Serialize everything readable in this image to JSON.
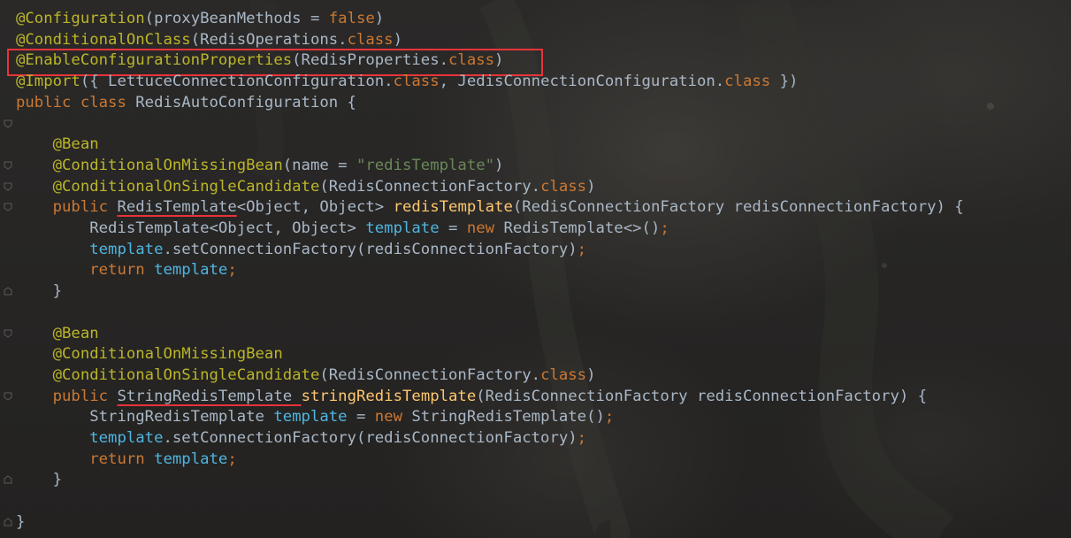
{
  "editor": {
    "lines": [
      {
        "kind": "plain",
        "tokens": [
          {
            "t": "ann",
            "v": "@Configuration"
          },
          {
            "t": "plain",
            "v": "(proxyBeanMethods = "
          },
          {
            "t": "kw",
            "v": "false"
          },
          {
            "t": "plain",
            "v": ")"
          }
        ]
      },
      {
        "kind": "plain",
        "tokens": [
          {
            "t": "ann",
            "v": "@ConditionalOnClass"
          },
          {
            "t": "plain",
            "v": "(RedisOperations."
          },
          {
            "t": "kw",
            "v": "class"
          },
          {
            "t": "plain",
            "v": ")"
          }
        ]
      },
      {
        "kind": "boxed",
        "tokens": [
          {
            "t": "ann",
            "v": "@EnableConfigurationProperties"
          },
          {
            "t": "plain",
            "v": "(RedisProperties."
          },
          {
            "t": "kw",
            "v": "class"
          },
          {
            "t": "plain",
            "v": ")"
          }
        ]
      },
      {
        "kind": "plain",
        "tokens": [
          {
            "t": "ann",
            "v": "@Import"
          },
          {
            "t": "plain",
            "v": "({ LettuceConnectionConfiguration."
          },
          {
            "t": "kw",
            "v": "class"
          },
          {
            "t": "plain",
            "v": ", JedisConnectionConfiguration."
          },
          {
            "t": "kw",
            "v": "class"
          },
          {
            "t": "plain",
            "v": " })"
          }
        ]
      },
      {
        "kind": "plain",
        "tokens": [
          {
            "t": "kw",
            "v": "public class "
          },
          {
            "t": "plain",
            "v": "RedisAutoConfiguration {"
          }
        ]
      },
      {
        "kind": "blank",
        "tokens": []
      },
      {
        "kind": "plain",
        "tokens": [
          {
            "t": "plain",
            "v": "    "
          },
          {
            "t": "ann",
            "v": "@Bean"
          }
        ]
      },
      {
        "kind": "plain",
        "tokens": [
          {
            "t": "plain",
            "v": "    "
          },
          {
            "t": "ann",
            "v": "@ConditionalOnMissingBean"
          },
          {
            "t": "plain",
            "v": "(name = "
          },
          {
            "t": "str",
            "v": "\"redisTemplate\""
          },
          {
            "t": "plain",
            "v": ")"
          }
        ]
      },
      {
        "kind": "plain",
        "tokens": [
          {
            "t": "plain",
            "v": "    "
          },
          {
            "t": "ann",
            "v": "@ConditionalOnSingleCandidate"
          },
          {
            "t": "plain",
            "v": "(RedisConnectionFactory."
          },
          {
            "t": "kw",
            "v": "class"
          },
          {
            "t": "plain",
            "v": ")"
          }
        ]
      },
      {
        "kind": "plain",
        "tokens": [
          {
            "t": "plain",
            "v": "    "
          },
          {
            "t": "kw",
            "v": "public "
          },
          {
            "t": "plain ul",
            "v": "RedisTemplate"
          },
          {
            "t": "plain",
            "v": "<Object, Object> "
          },
          {
            "t": "fn",
            "v": "redisTemplate"
          },
          {
            "t": "plain",
            "v": "(RedisConnectionFactory redisConnectionFactory) {"
          }
        ]
      },
      {
        "kind": "plain",
        "tokens": [
          {
            "t": "plain",
            "v": "        RedisTemplate<Object, Object> "
          },
          {
            "t": "fld",
            "v": "template"
          },
          {
            "t": "plain",
            "v": " = "
          },
          {
            "t": "kw",
            "v": "new "
          },
          {
            "t": "plain",
            "v": "RedisTemplate<>()"
          },
          {
            "t": "kw",
            "v": ";"
          }
        ]
      },
      {
        "kind": "plain",
        "tokens": [
          {
            "t": "plain",
            "v": "        "
          },
          {
            "t": "fld",
            "v": "template"
          },
          {
            "t": "plain",
            "v": ".setConnectionFactory(redisConnectionFactory)"
          },
          {
            "t": "kw",
            "v": ";"
          }
        ]
      },
      {
        "kind": "plain",
        "tokens": [
          {
            "t": "plain",
            "v": "        "
          },
          {
            "t": "kw",
            "v": "return "
          },
          {
            "t": "fld",
            "v": "template"
          },
          {
            "t": "kw",
            "v": ";"
          }
        ]
      },
      {
        "kind": "plain",
        "tokens": [
          {
            "t": "plain",
            "v": "    }"
          }
        ]
      },
      {
        "kind": "blank",
        "tokens": []
      },
      {
        "kind": "plain",
        "tokens": [
          {
            "t": "plain",
            "v": "    "
          },
          {
            "t": "ann",
            "v": "@Bean"
          }
        ]
      },
      {
        "kind": "plain",
        "tokens": [
          {
            "t": "plain",
            "v": "    "
          },
          {
            "t": "ann",
            "v": "@ConditionalOnMissingBean"
          }
        ]
      },
      {
        "kind": "plain",
        "tokens": [
          {
            "t": "plain",
            "v": "    "
          },
          {
            "t": "ann",
            "v": "@ConditionalOnSingleCandidate"
          },
          {
            "t": "plain",
            "v": "(RedisConnectionFactory."
          },
          {
            "t": "kw",
            "v": "class"
          },
          {
            "t": "plain",
            "v": ")"
          }
        ]
      },
      {
        "kind": "plain",
        "tokens": [
          {
            "t": "plain",
            "v": "    "
          },
          {
            "t": "kw",
            "v": "public "
          },
          {
            "t": "plain ul",
            "v": "StringRedisTemplate "
          },
          {
            "t": "fn",
            "v": "stringRedisTemplate"
          },
          {
            "t": "plain",
            "v": "(RedisConnectionFactory redisConnectionFactory) {"
          }
        ]
      },
      {
        "kind": "plain",
        "tokens": [
          {
            "t": "plain",
            "v": "        StringRedisTemplate "
          },
          {
            "t": "fld",
            "v": "template"
          },
          {
            "t": "plain",
            "v": " = "
          },
          {
            "t": "kw",
            "v": "new "
          },
          {
            "t": "plain",
            "v": "StringRedisTemplate()"
          },
          {
            "t": "kw",
            "v": ";"
          }
        ]
      },
      {
        "kind": "plain",
        "tokens": [
          {
            "t": "plain",
            "v": "        "
          },
          {
            "t": "fld",
            "v": "template"
          },
          {
            "t": "plain",
            "v": ".setConnectionFactory(redisConnectionFactory)"
          },
          {
            "t": "kw",
            "v": ";"
          }
        ]
      },
      {
        "kind": "plain",
        "tokens": [
          {
            "t": "plain",
            "v": "        "
          },
          {
            "t": "kw",
            "v": "return "
          },
          {
            "t": "fld",
            "v": "template"
          },
          {
            "t": "kw",
            "v": ";"
          }
        ]
      },
      {
        "kind": "plain",
        "tokens": [
          {
            "t": "plain",
            "v": "    }"
          }
        ]
      },
      {
        "kind": "blank",
        "tokens": []
      },
      {
        "kind": "plain",
        "tokens": [
          {
            "t": "plain",
            "v": "}"
          }
        ]
      }
    ],
    "fold_markers": [
      {
        "line": 5,
        "icon": "fold-open-icon"
      },
      {
        "line": 7,
        "icon": "fold-open-icon"
      },
      {
        "line": 8,
        "icon": "fold-open-icon"
      },
      {
        "line": 9,
        "icon": "fold-open-icon"
      },
      {
        "line": 13,
        "icon": "fold-close-icon"
      },
      {
        "line": 15,
        "icon": "fold-open-icon"
      },
      {
        "line": 18,
        "icon": "fold-open-icon"
      },
      {
        "line": 22,
        "icon": "fold-close-icon"
      },
      {
        "line": 24,
        "icon": "fold-close-icon"
      }
    ],
    "colors": {
      "annotation": "#bbb529",
      "keyword": "#cc7832",
      "method": "#ffc66d",
      "field": "#4fb5e0",
      "string": "#6a8759",
      "text": "#a9b7c6",
      "highlight": "#e8333a"
    }
  }
}
